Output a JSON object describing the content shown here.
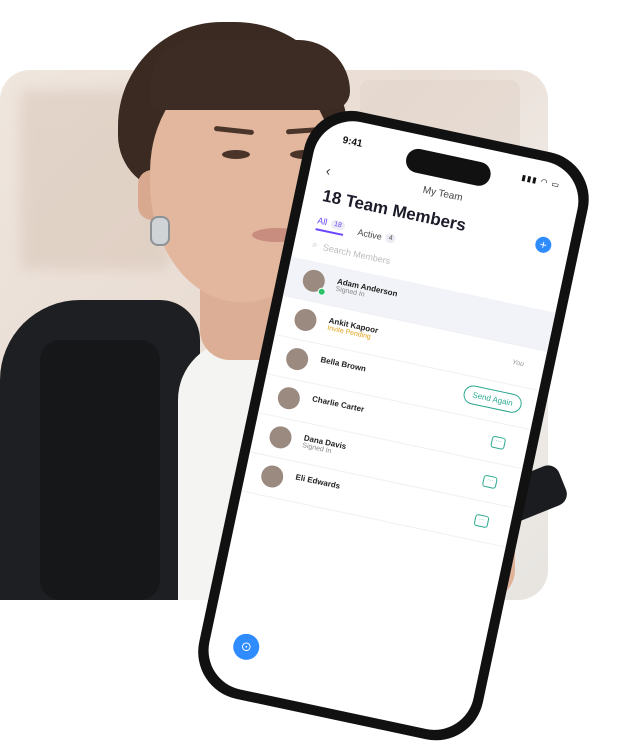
{
  "status": {
    "time": "9:41",
    "icons": "▮▮▮ ◠ ▭"
  },
  "header": {
    "back": "‹",
    "nav_title": "My Team",
    "headline": "18 Team Members",
    "add": "+"
  },
  "tabs": [
    {
      "label": "All",
      "count": "18"
    },
    {
      "label": "Active",
      "count": "4"
    }
  ],
  "search": {
    "placeholder": "Search Members",
    "icon": "⌕"
  },
  "members": [
    {
      "name": "Adam Anderson",
      "status": "Signed In"
    },
    {
      "name": "Ankit Kapoor",
      "status": "Invite Pending",
      "tag": "You"
    },
    {
      "name": "Bella Brown",
      "action": "Send Again"
    },
    {
      "name": "Charlie Carter"
    },
    {
      "name": "Dana Davis",
      "status": "Signed In"
    },
    {
      "name": "Eli Edwards"
    }
  ],
  "fab_icon": "⊙",
  "chat_icon": "···"
}
